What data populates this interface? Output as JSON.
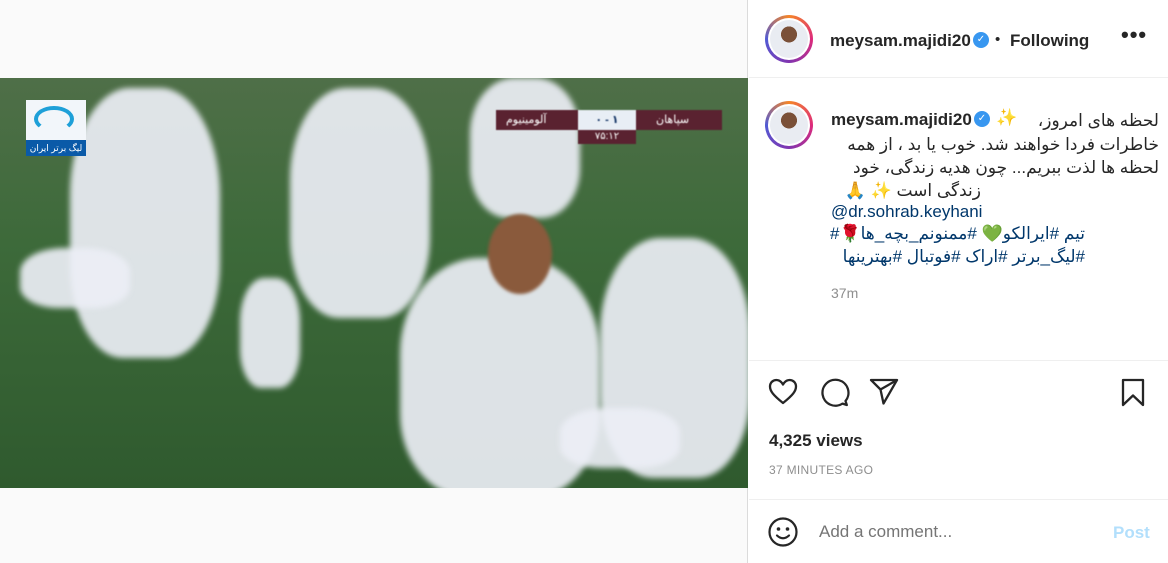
{
  "media": {
    "tv_logo_text": "لیگ برتر ایران",
    "scoreboard": {
      "home": "سپاهان",
      "away": "آلومینیوم",
      "score": "۰ - ۱",
      "clock": "۷۵:۱۲"
    }
  },
  "header": {
    "username": "meysam.majidi20",
    "separator": "•",
    "follow_status": "Following",
    "more": "•••"
  },
  "caption": {
    "username": "meysam.majidi20",
    "sparkle": "✨",
    "lines": [
      "لحظه های امروز،",
      "خاطرات فردا خواهند شد. خوب یا بد ، از همه",
      "لحظه ها لذت ببریم... چون هدیه زندگی، خود",
      "زندگی است ✨ 🙏"
    ],
    "mention": "@dr.sohrab.keyhani",
    "hashtag_line1": "تیم #ایرالکو💚 #ممنونم_بچه_ها🌹#",
    "hashtag_line2": "#لیگ_برتر #اراک #فوتبال #بهترینها",
    "time_ago": "37m"
  },
  "stats": {
    "views": "4,325 views",
    "posted": "37 MINUTES AGO"
  },
  "comment": {
    "placeholder": "Add a comment...",
    "post_label": "Post"
  },
  "icons": [
    "heart-icon",
    "comment-icon",
    "share-icon",
    "bookmark-icon",
    "emoji-icon",
    "more-icon",
    "verified-icon"
  ]
}
